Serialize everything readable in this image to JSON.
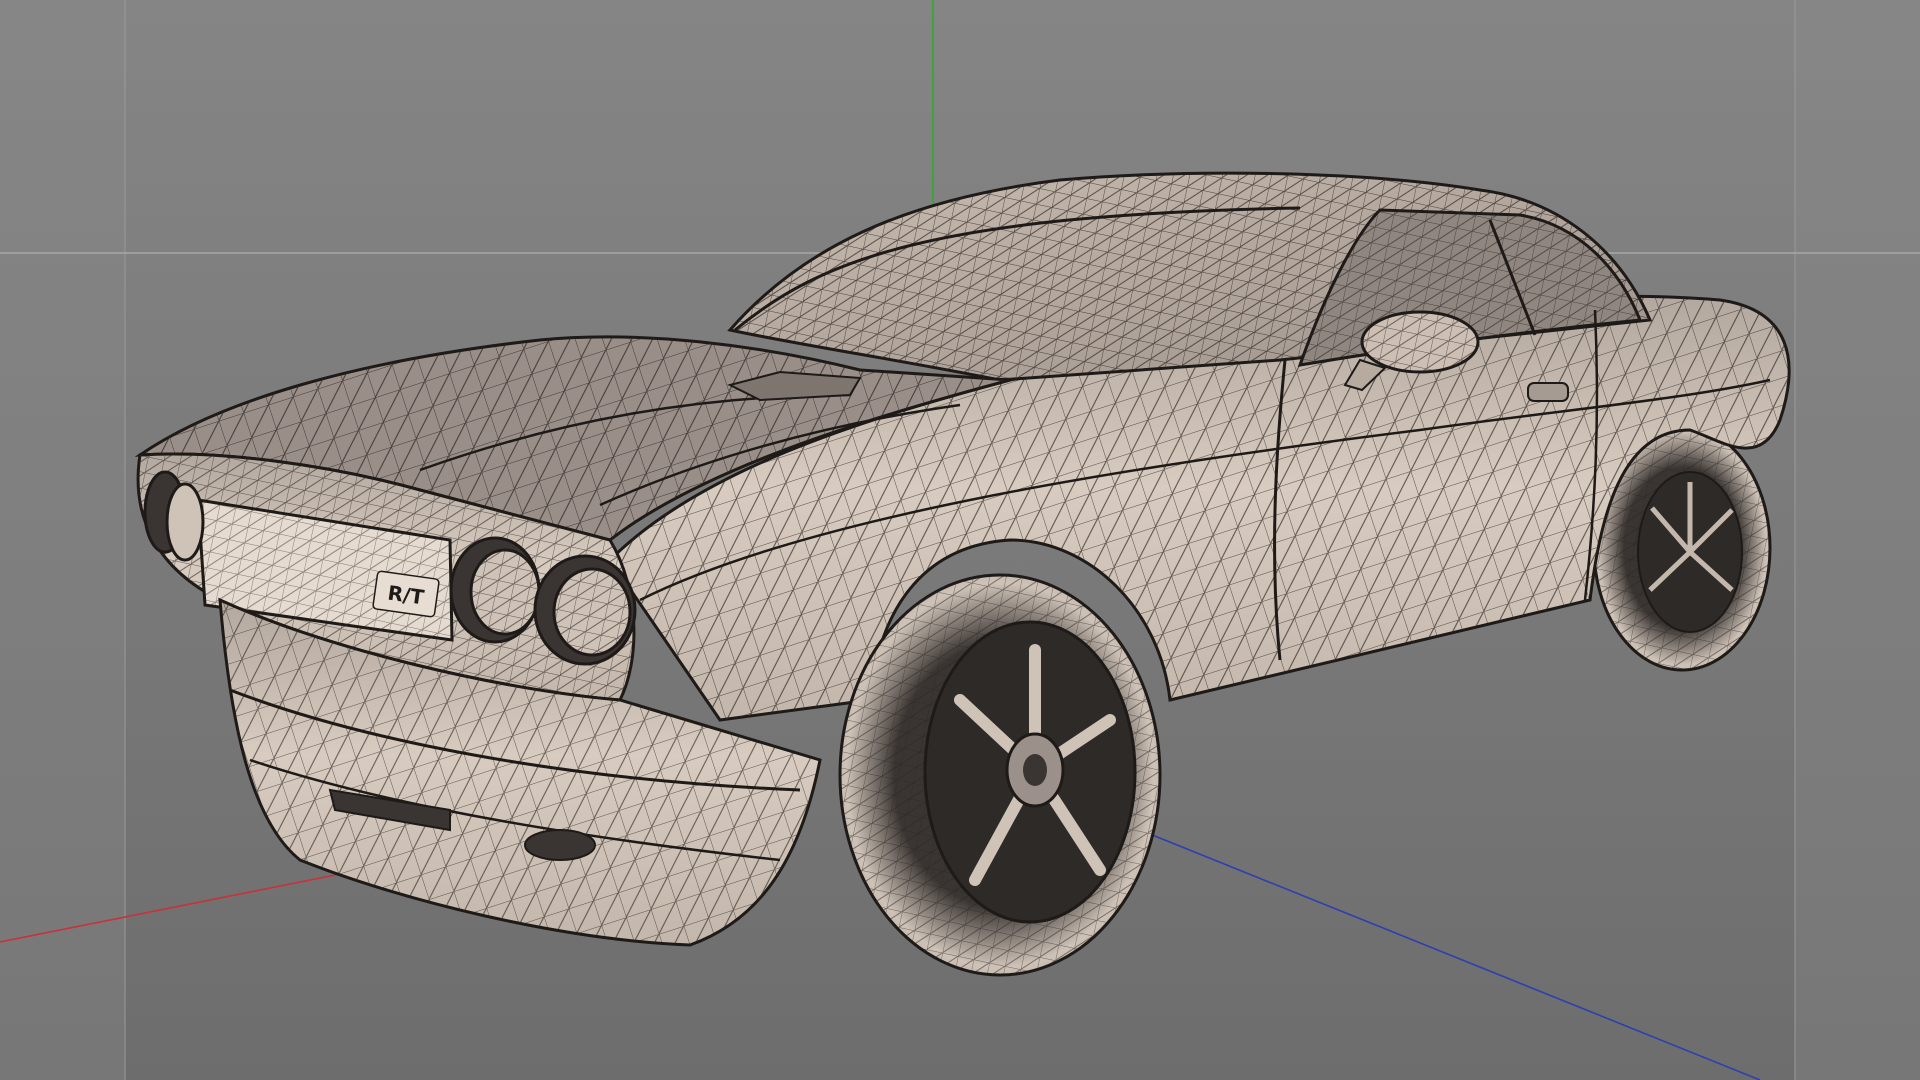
{
  "viewport": {
    "background_color": "#7d7d7d",
    "safe_frame_color": "#8a8a8a",
    "horizon_line_color": "#a8a8a8"
  },
  "axes": {
    "x_axis_color": "#c8323c",
    "y_axis_color": "#3ea23e",
    "z_axis_color": "#2e3fb0"
  },
  "model": {
    "display_mode": "wireframe-shaded",
    "shade_color": "#d9ccc0",
    "wire_color": "#1e1a18",
    "badge_text": "R/T"
  }
}
